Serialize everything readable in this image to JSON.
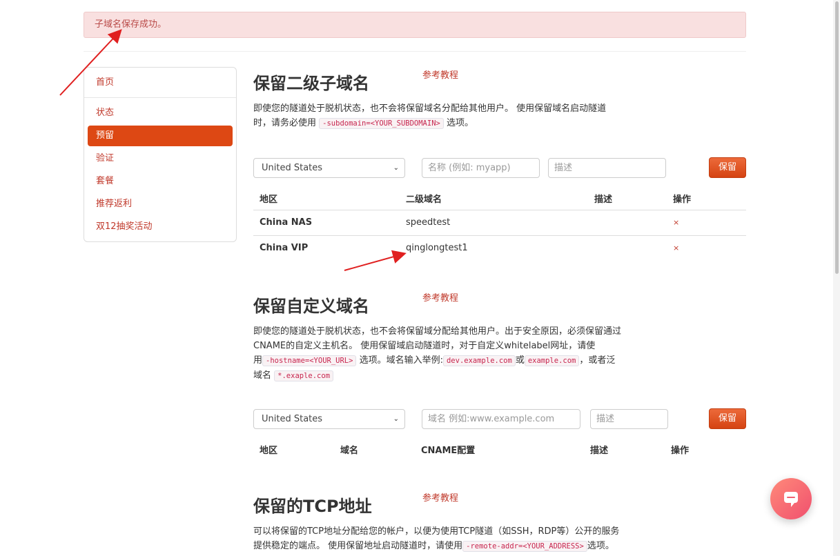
{
  "alert": {
    "text": "子域名保存成功。"
  },
  "sidebar": {
    "items": [
      {
        "label": "首页"
      },
      {
        "label": "状态"
      },
      {
        "label": "预留"
      },
      {
        "label": "验证"
      },
      {
        "label": "套餐"
      },
      {
        "label": "推荐返利"
      },
      {
        "label": "双12抽奖活动"
      }
    ]
  },
  "subdomain": {
    "title": "保留二级子域名",
    "ref": "参考教程",
    "desc1": "即使您的隧道处于脱机状态，也不会将保留域名分配给其他用户。 使用保留域名启动隧道",
    "desc2a": "时，请务必使用",
    "code": "-subdomain=<YOUR_SUBDOMAIN>",
    "desc2b": "选项。",
    "region_value": "United States",
    "name_placeholder": "名称 (例如: myapp)",
    "desc_placeholder": "描述",
    "save_label": "保留",
    "headers": [
      "地区",
      "二级域名",
      "描述",
      "操作"
    ],
    "rows": [
      {
        "region": "China NAS",
        "subdomain": "speedtest",
        "desc": "",
        "action": "×"
      },
      {
        "region": "China VIP",
        "subdomain": "qinglongtest1",
        "desc": "",
        "action": "×"
      }
    ]
  },
  "customdomain": {
    "title": "保留自定义域名",
    "ref": "参考教程",
    "desc1": "即使您的隧道处于脱机状态，也不会将保留域分配给其他用户。出于安全原因，必须保留通过",
    "desc2": "CNAME的自定义主机名。 使用保留域启动隧道时，对于自定义whitelabel网址，请使",
    "desc3a": "用",
    "code1": "-hostname=<YOUR_URL>",
    "desc3b": "选项。域名输入举例:",
    "code2": "dev.example.com",
    "desc3c": "或",
    "code3": "example.com",
    "desc3d": "，或者泛",
    "desc4a": "域名",
    "code4": "*.exaple.com",
    "region_value": "United States",
    "domain_placeholder": "域名 例如:www.example.com",
    "desc_placeholder": "描述",
    "save_label": "保留",
    "headers": [
      "地区",
      "域名",
      "CNAME配置",
      "描述",
      "操作"
    ]
  },
  "tcp": {
    "title": "保留的TCP地址",
    "ref": "参考教程",
    "desc1": "可以将保留的TCP地址分配给您的帐户，以便为使用TCP隧道（如SSH，RDP等）公开的服务",
    "desc2a": "提供稳定的端点。 使用保留地址启动隧道时，请使用",
    "code": "-remote-addr=<YOUR_ADDRESS>",
    "desc2b": "选项。"
  },
  "colors": {
    "accent": "#dd4814",
    "link": "#c0392b",
    "alert_bg": "#f9e0e0",
    "annotation_arrow": "#e02020"
  },
  "icons": {
    "chat": "chat-bubble-icon",
    "delete": "close-icon",
    "dropdown": "chevron-down-icon"
  }
}
